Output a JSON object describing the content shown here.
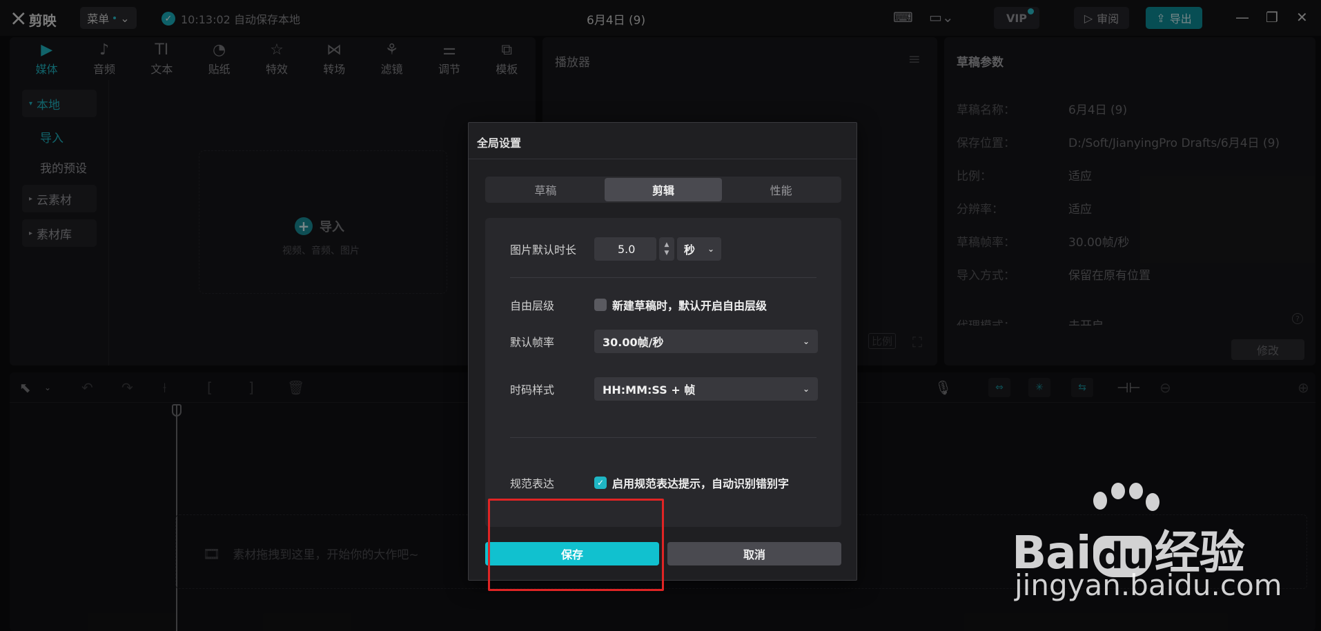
{
  "app": {
    "name": "剪映",
    "menu_label": "菜单",
    "autosave_text": "10:13:02 自动保存本地",
    "doc_title": "6月4日 (9)",
    "vip_label": "VIP",
    "review_label": "审阅",
    "export_label": "导出"
  },
  "media_panel": {
    "tabs": [
      {
        "label": "媒体",
        "icon": "media-icon"
      },
      {
        "label": "音频",
        "icon": "audio-icon"
      },
      {
        "label": "文本",
        "icon": "text-icon"
      },
      {
        "label": "贴纸",
        "icon": "sticker-icon"
      },
      {
        "label": "特效",
        "icon": "effects-icon"
      },
      {
        "label": "转场",
        "icon": "transition-icon"
      },
      {
        "label": "滤镜",
        "icon": "filter-icon"
      },
      {
        "label": "调节",
        "icon": "adjust-icon"
      },
      {
        "label": "模板",
        "icon": "template-icon"
      }
    ],
    "side": {
      "local": "本地",
      "import": "导入",
      "presets": "我的预设",
      "cloud": "云素材",
      "library": "素材库"
    },
    "import_box": {
      "label": "导入",
      "sub": "视频、音频、图片"
    }
  },
  "player": {
    "title": "播放器",
    "ratio_label": "比例"
  },
  "draft": {
    "title": "草稿参数",
    "rows": [
      {
        "k": "草稿名称：",
        "v": "6月4日 (9)"
      },
      {
        "k": "保存位置：",
        "v": "D:/Soft/JianyingPro Drafts/6月4日 (9)"
      },
      {
        "k": "比例：",
        "v": "适应"
      },
      {
        "k": "分辨率：",
        "v": "适应"
      },
      {
        "k": "草稿帧率：",
        "v": "30.00帧/秒"
      },
      {
        "k": "导入方式：",
        "v": "保留在原有位置"
      },
      {
        "k": "代理模式：",
        "v": "未开启"
      }
    ],
    "modify_label": "修改"
  },
  "timeline": {
    "hint": "素材拖拽到这里，开始你的大作吧~"
  },
  "dialog": {
    "title": "全局设置",
    "tabs": [
      "草稿",
      "剪辑",
      "性能"
    ],
    "active_tab": "剪辑",
    "image_duration": {
      "label": "图片默认时长",
      "value": "5.0",
      "unit": "秒"
    },
    "free_layer": {
      "label": "自由层级",
      "text": "新建草稿时，默认开启自由层级",
      "checked": false
    },
    "frame_rate": {
      "label": "默认帧率",
      "value": "30.00帧/秒"
    },
    "timecode": {
      "label": "时码样式",
      "value": "HH:MM:SS + 帧"
    },
    "norm": {
      "label": "规范表达",
      "text": "启用规范表达提示，自动识别错别字",
      "checked": true
    },
    "save_label": "保存",
    "cancel_label": "取消"
  },
  "watermark": {
    "main": "Bai du 经验",
    "sub": "jingyan.baidu.com"
  },
  "colors": {
    "accent": "#11c1cf",
    "highlight": "#e02424"
  }
}
